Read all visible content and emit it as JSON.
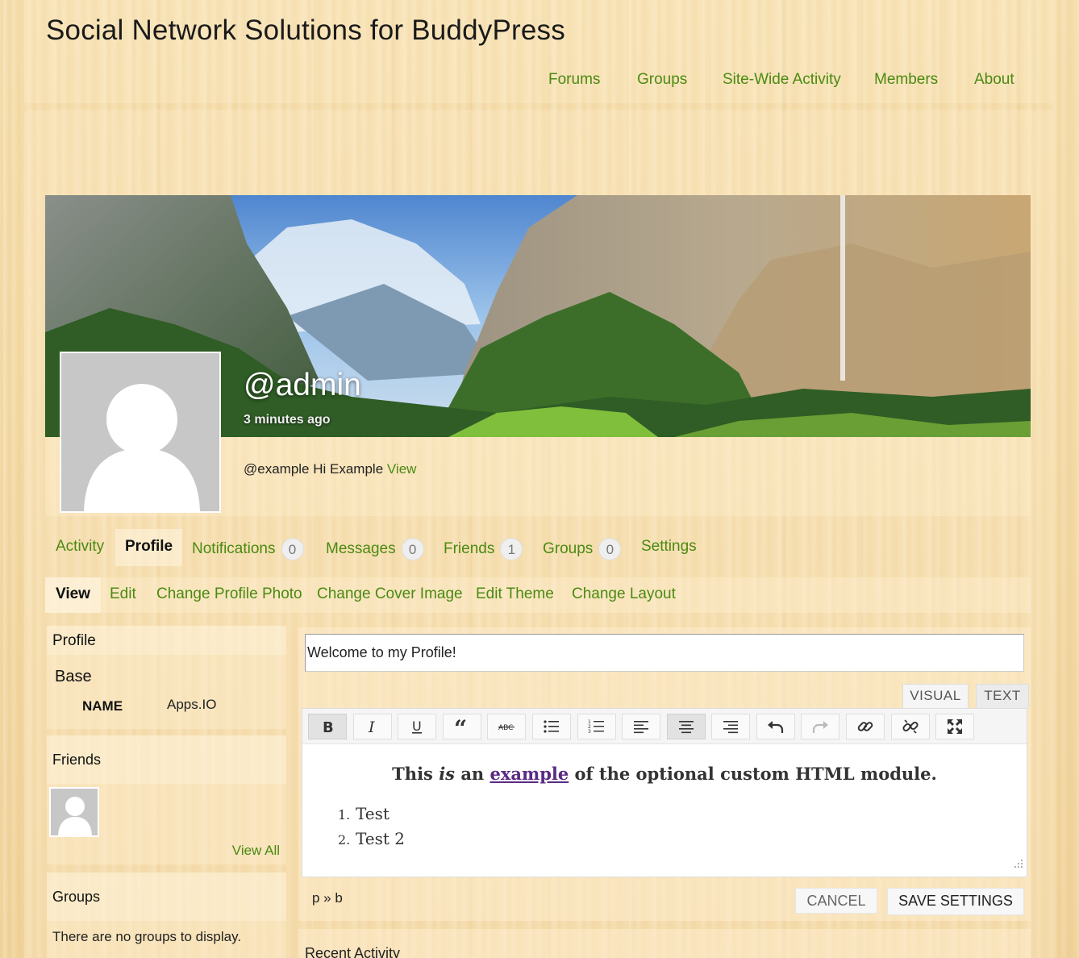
{
  "site": {
    "title": "Social Network Solutions for BuddyPress"
  },
  "top_nav": [
    "Forums",
    "Groups",
    "Site-Wide Activity",
    "Members",
    "About"
  ],
  "profile": {
    "handle": "@admin",
    "last_active": "3 minutes ago",
    "latest_update_text": "@example Hi Example",
    "latest_update_link": "View"
  },
  "primary_nav": {
    "activity": "Activity",
    "profile": "Profile",
    "notifications": "Notifications",
    "notifications_count": "0",
    "messages": "Messages",
    "messages_count": "0",
    "friends": "Friends",
    "friends_count": "1",
    "groups": "Groups",
    "groups_count": "0",
    "settings": "Settings"
  },
  "sub_nav": [
    "View",
    "Edit",
    "Change Profile Photo",
    "Change Cover Image",
    "Edit Theme",
    "Change Layout"
  ],
  "sidebar": {
    "profile_title": "Profile",
    "base_title": "Base",
    "field_name": "NAME",
    "field_value": "Apps.IO",
    "friends_title": "Friends",
    "view_all": "View All",
    "groups_title": "Groups",
    "no_groups": "There are no groups to display."
  },
  "editor": {
    "title_value": "Welcome to my Profile!",
    "visual_tab": "VISUAL",
    "text_tab": "TEXT",
    "heading_pre": "This",
    "heading_em": "is",
    "heading_mid": "an",
    "heading_link": "example",
    "heading_post": "of the optional custom HTML module.",
    "list": [
      "Test",
      "Test 2"
    ],
    "path": "p » b",
    "toolbar_icons": [
      "bold-icon",
      "italic-icon",
      "underline-icon",
      "blockquote-icon",
      "strikethrough-icon",
      "bullet-list-icon",
      "numbered-list-icon",
      "align-left-icon",
      "align-center-icon",
      "align-right-icon",
      "undo-icon",
      "redo-icon",
      "link-icon",
      "unlink-icon",
      "fullscreen-icon"
    ],
    "cancel_label": "CANCEL",
    "save_label": "SAVE SETTINGS"
  },
  "recent_activity_title": "Recent Activity",
  "colors": {
    "link_green": "#4a8a12",
    "link_purple": "#5a2a83"
  }
}
